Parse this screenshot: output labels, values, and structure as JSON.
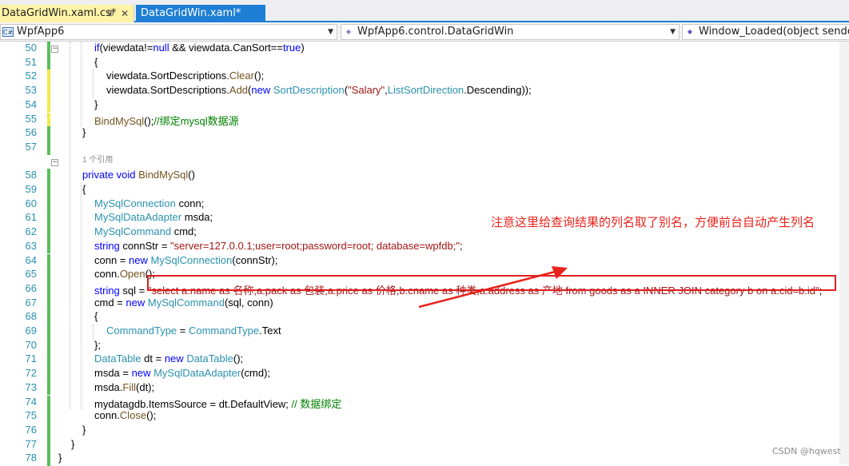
{
  "tabs": [
    {
      "label": "DataGridWin.xaml.cs*",
      "active": true
    },
    {
      "label": "DataGridWin.xaml*",
      "active": false
    }
  ],
  "tab_icons": {
    "pin": "⊕",
    "close": "✕"
  },
  "nav": {
    "project": "WpfApp6",
    "class": "WpfApp6.control.DataGridWin",
    "member": "Window_Loaded(object sender, R"
  },
  "code_lines": [
    {
      "n": "50",
      "text": "if(viewdata!=null && viewdata.CanSort==true)"
    },
    {
      "n": "51",
      "text": "{"
    },
    {
      "n": "52",
      "text": "viewdata.SortDescriptions.Clear();"
    },
    {
      "n": "53",
      "text": "viewdata.SortDescriptions.Add(new SortDescription(\"Salary\",ListSortDirection.Descending));"
    },
    {
      "n": "54",
      "text": "}"
    },
    {
      "n": "55",
      "text": "BindMySql();//绑定mysql数据源"
    },
    {
      "n": "56",
      "text": "}"
    },
    {
      "n": "57",
      "text": ""
    },
    {
      "n": "58",
      "text": "private void BindMySql()"
    },
    {
      "n": "59",
      "text": "{"
    },
    {
      "n": "60",
      "text": "MySqlConnection conn;"
    },
    {
      "n": "61",
      "text": "MySqlDataAdapter msda;"
    },
    {
      "n": "62",
      "text": "MySqlCommand cmd;"
    },
    {
      "n": "63",
      "text": "string connStr = \"server=127.0.0.1;user=root;password=root; database=wpfdb;\";"
    },
    {
      "n": "64",
      "text": "conn = new MySqlConnection(connStr);"
    },
    {
      "n": "65",
      "text": "conn.Open();"
    },
    {
      "n": "66",
      "text": "string sql = \"select a.name as 名称,a.pack as 包装,a.price as 价格,b.cname as 种类,a.address as 产地 from goods as a INNER JOIN category b on a.cid=b.id\";"
    },
    {
      "n": "67",
      "text": "cmd = new MySqlCommand(sql, conn)"
    },
    {
      "n": "68",
      "text": "{"
    },
    {
      "n": "69",
      "text": "CommandType = CommandType.Text"
    },
    {
      "n": "70",
      "text": "};"
    },
    {
      "n": "71",
      "text": "DataTable dt = new DataTable();"
    },
    {
      "n": "72",
      "text": "msda = new MySqlDataAdapter(cmd);"
    },
    {
      "n": "73",
      "text": "msda.Fill(dt);"
    },
    {
      "n": "74",
      "text": "mydatagdb.ItemsSource = dt.DefaultView; // 数据绑定"
    },
    {
      "n": "75",
      "text": "conn.Close();"
    },
    {
      "n": "76",
      "text": "}"
    },
    {
      "n": "77",
      "text": "}"
    },
    {
      "n": "78",
      "text": "}"
    }
  ],
  "reference_hint": "1 个引用",
  "annotation": "注意这里给查询结果的列名取了别名，方便前台自动产生列名",
  "watermark": "CSDN @hqwest",
  "colors": {
    "keyword": "#0000ff",
    "type": "#2b91af",
    "string": "#a31515",
    "comment": "#008000",
    "annotation": "#e8231c",
    "tab_active": "#fff3a8",
    "tab_inactive": "#1e7ed4"
  }
}
